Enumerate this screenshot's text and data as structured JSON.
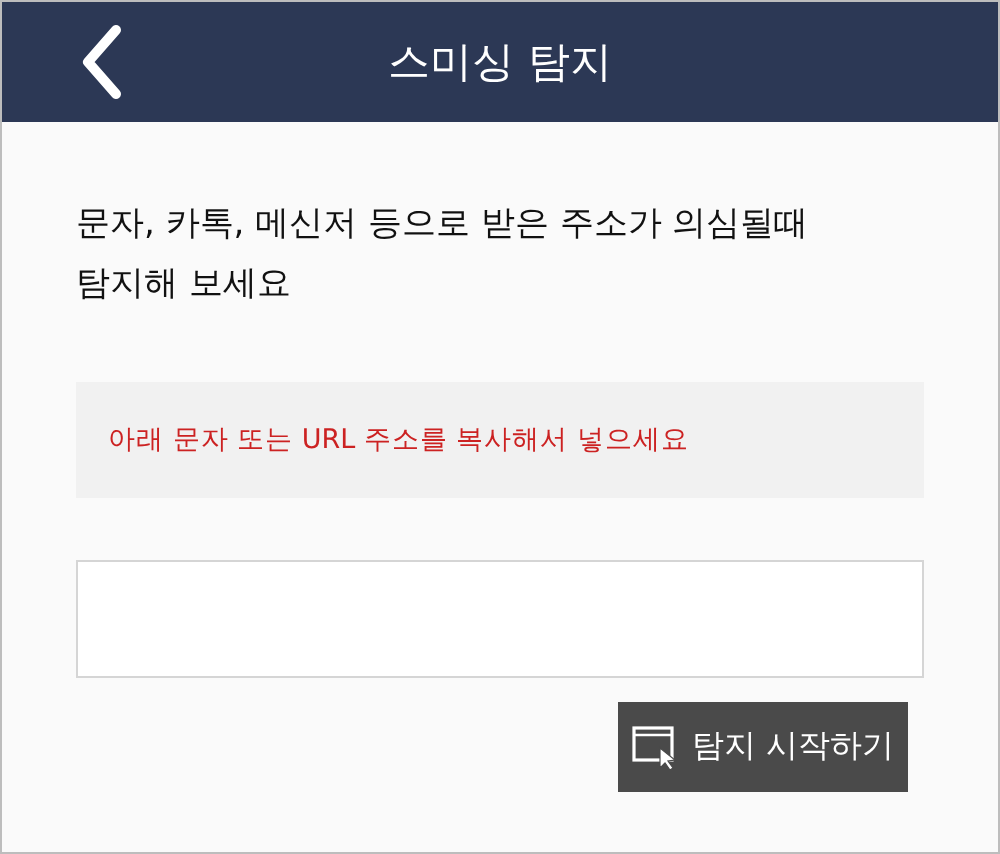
{
  "header": {
    "title": "스미싱 탐지"
  },
  "intro": {
    "lines": [
      "문자, 카톡, 메신저 등으로 받은 주소가 의심될때",
      "탐지해 보세요"
    ]
  },
  "notice": "아래 문자 또는 URL 주소를 복사해서 넣으세요",
  "button": {
    "label": "탐지 시작하기"
  }
}
